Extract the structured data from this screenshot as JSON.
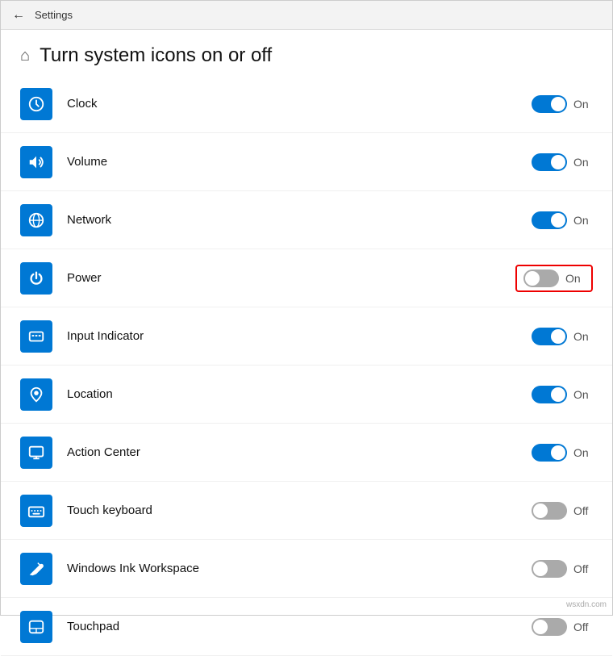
{
  "titlebar": {
    "back_label": "←",
    "title": "Settings"
  },
  "page": {
    "home_icon": "⌂",
    "title": "Turn system icons on or off"
  },
  "items": [
    {
      "id": "clock",
      "label": "Clock",
      "state": "on",
      "state_label": "On",
      "highlighted": false
    },
    {
      "id": "volume",
      "label": "Volume",
      "state": "on",
      "state_label": "On",
      "highlighted": false
    },
    {
      "id": "network",
      "label": "Network",
      "state": "on",
      "state_label": "On",
      "highlighted": false
    },
    {
      "id": "power",
      "label": "Power",
      "state": "on",
      "state_label": "On",
      "highlighted": true
    },
    {
      "id": "input-indicator",
      "label": "Input Indicator",
      "state": "on",
      "state_label": "On",
      "highlighted": false
    },
    {
      "id": "location",
      "label": "Location",
      "state": "on",
      "state_label": "On",
      "highlighted": false
    },
    {
      "id": "action-center",
      "label": "Action Center",
      "state": "on",
      "state_label": "On",
      "highlighted": false
    },
    {
      "id": "touch-keyboard",
      "label": "Touch keyboard",
      "state": "off",
      "state_label": "Off",
      "highlighted": false
    },
    {
      "id": "windows-ink",
      "label": "Windows Ink Workspace",
      "state": "off",
      "state_label": "Off",
      "highlighted": false
    },
    {
      "id": "touchpad",
      "label": "Touchpad",
      "state": "off",
      "state_label": "Off",
      "highlighted": false
    }
  ],
  "watermark": "wsxdn.com"
}
